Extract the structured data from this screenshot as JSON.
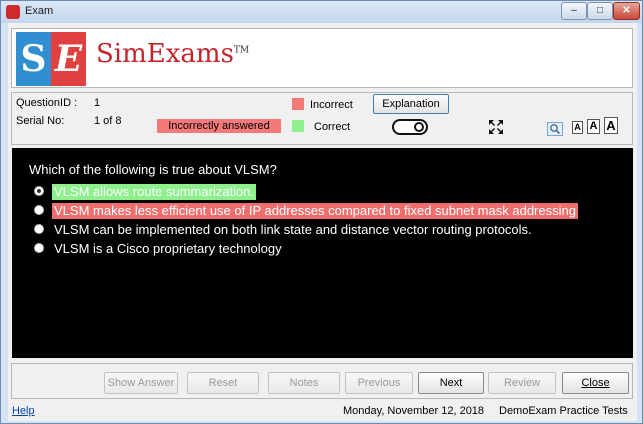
{
  "window": {
    "title": "Exam",
    "controls": [
      "–",
      "□",
      "✕"
    ]
  },
  "logo": {
    "letter_s": "S",
    "letter_e": "E",
    "brand": "SimExams",
    "trademark": "TM"
  },
  "info": {
    "question_id_label": "QuestionID :",
    "question_id_value": "1",
    "serial_label": "Serial No:",
    "serial_value": "1 of 8",
    "status_badge": "Incorrectly answered",
    "legend_incorrect": "Incorrect",
    "legend_correct": "Correct",
    "explanation_button": "Explanation",
    "font_sizes": [
      "A",
      "A",
      "A"
    ]
  },
  "question": {
    "text": "Which of the following is true about VLSM?",
    "options": [
      {
        "text": "VLSM allows route summarization.",
        "state": "correct",
        "selected": true
      },
      {
        "text": "VLSM makes less efficient use of IP addresses compared to fixed subnet mask addressing",
        "state": "wrong",
        "selected": false
      },
      {
        "text": "VLSM can be implemented on both link state and distance vector routing protocols.",
        "state": "none",
        "selected": false
      },
      {
        "text": "VLSM is a Cisco proprietary technology",
        "state": "none",
        "selected": false
      }
    ]
  },
  "buttons": {
    "show_answer": "Show Answer",
    "reset": "Reset",
    "notes": "Notes",
    "previous": "Previous",
    "next": "Next",
    "review": "Review",
    "close": "Close"
  },
  "status_bar": {
    "help": "Help",
    "date": "Monday, November 12, 2018",
    "footer": "DemoExam Practice Tests"
  },
  "colors": {
    "incorrect": "#f47a7a",
    "correct": "#8df08d",
    "brand_red": "#c4252d",
    "brand_blue": "#2f8fd0"
  }
}
